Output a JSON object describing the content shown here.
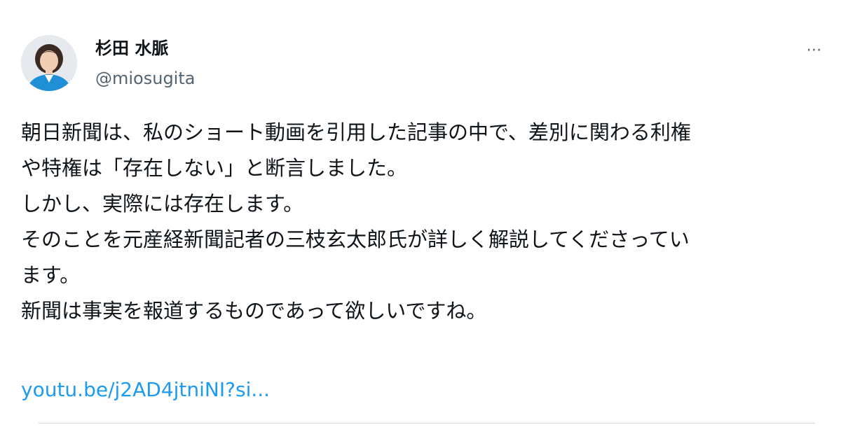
{
  "author": {
    "display_name": "杉田 水脈",
    "handle": "@miosugita"
  },
  "more_icon": "⋯",
  "body_lines": [
    "朝日新聞は、私のショート動画を引用した記事の中で、差別に関わる利権",
    "や特権は「存在しない」と断言しました。",
    "しかし、実際には存在します。",
    "そのことを元産経新聞記者の三枝玄太郎氏が詳しく解説してくださってい",
    "ます。",
    "新聞は事実を報道するものであって欲しいですね。"
  ],
  "link_text": "youtu.be/j2AD4jtniNI?si...",
  "colors": {
    "text": "#0f1419",
    "secondary": "#536471",
    "link": "#1d9bf0",
    "divider": "#cfd9de"
  },
  "icons": {
    "more": "more-options-icon",
    "avatar": "profile-photo"
  }
}
